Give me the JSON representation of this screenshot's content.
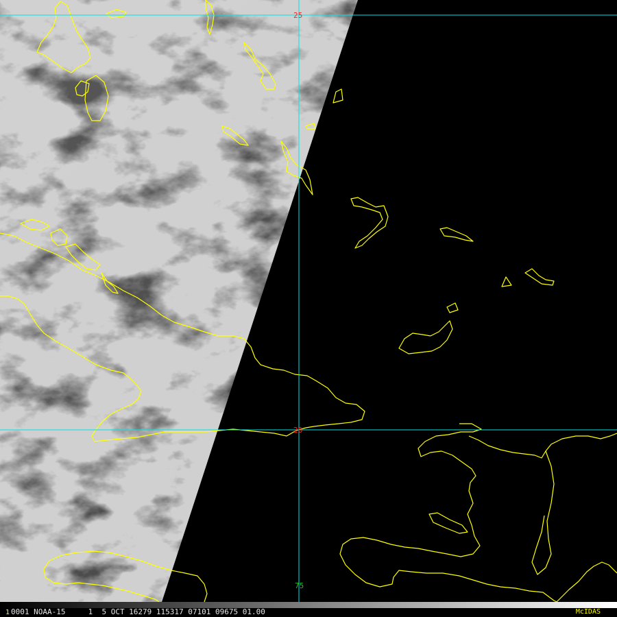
{
  "image": {
    "colors": {
      "coastline": "#ffff00",
      "gridline": "#00e5e5",
      "lat_label": "#ff2020",
      "lon_label": "#20c020",
      "status_text": "#e6e6e6",
      "brand": "#ffff00"
    },
    "gridlines": {
      "latitudes": [
        {
          "value": 25,
          "label": "25"
        },
        {
          "value": 20,
          "label": "20"
        }
      ],
      "longitudes": [
        {
          "value": 75,
          "label": "75"
        }
      ]
    },
    "status_bar": {
      "frame_number": "1",
      "text": "0001 NOAA-15     1  5 OCT 16279 115317 07101 09675 01.00",
      "brand": "McIDAS"
    }
  }
}
